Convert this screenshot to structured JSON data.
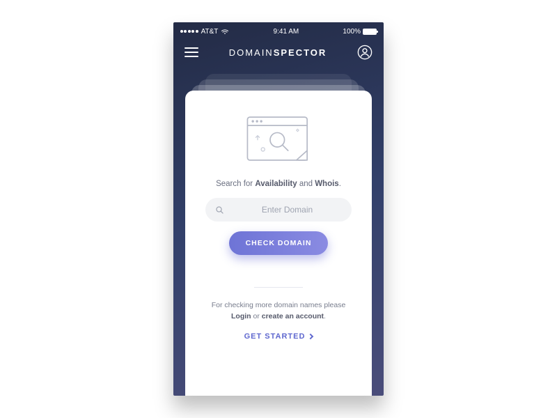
{
  "status": {
    "carrier": "AT&T",
    "time": "9:41 AM",
    "battery": "100%"
  },
  "header": {
    "title_thin": "DOMAIN",
    "title_bold": "SPECTOR"
  },
  "card": {
    "tag_prefix": "Search for ",
    "tag_b1": "Availability",
    "tag_mid": " and ",
    "tag_b2": "Whois",
    "tag_suffix": ".",
    "search_placeholder": "Enter Domain",
    "check_label": "CHECK DOMAIN",
    "footer_line1": "For checking more domain names  please",
    "footer_login": "Login",
    "footer_or": " or ",
    "footer_create": "create an account",
    "footer_suffix": ".",
    "get_started": "GET STARTED"
  }
}
